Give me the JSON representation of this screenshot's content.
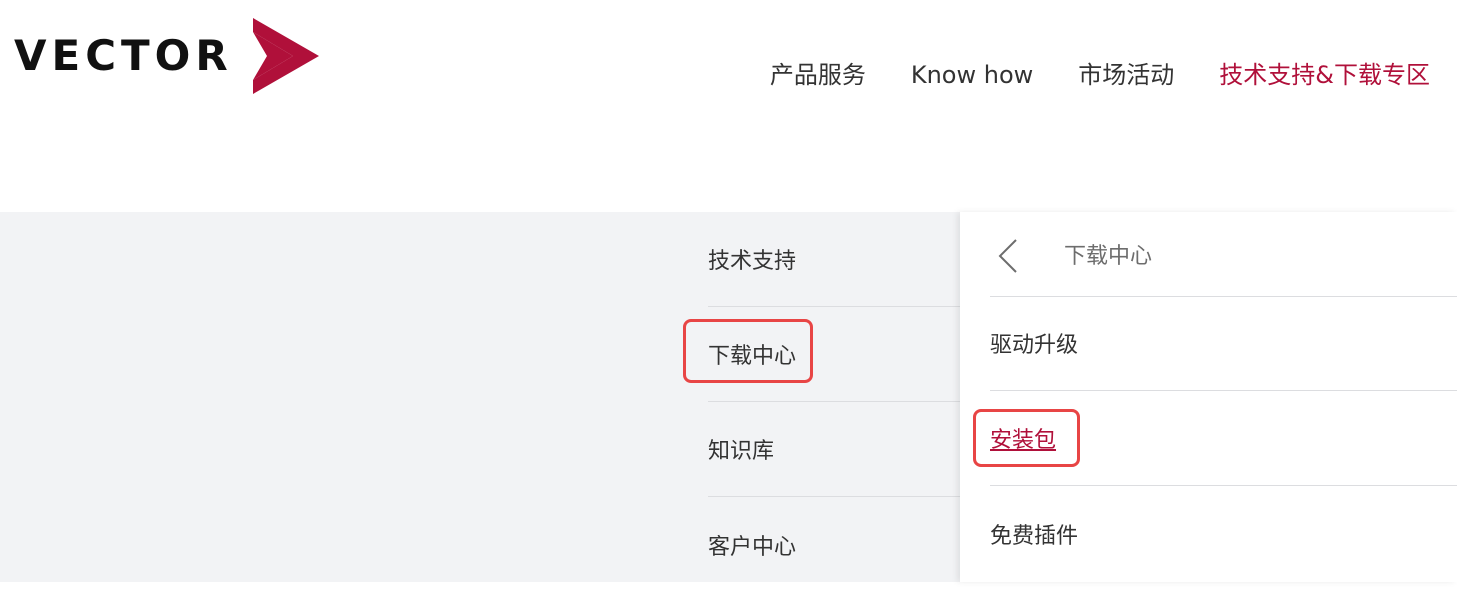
{
  "brand": {
    "logo_text": "VECTOR",
    "logo_icon": "red-chevron-arrow",
    "accent_color": "#b0103a"
  },
  "topnav": {
    "items": [
      {
        "label": "产品服务"
      },
      {
        "label": "Know how"
      },
      {
        "label": "市场活动"
      },
      {
        "label": "技术支持&下载专区",
        "active": true
      }
    ]
  },
  "left_menu": {
    "items": [
      {
        "label": "技术支持"
      },
      {
        "label": "下载中心",
        "highlighted": true
      },
      {
        "label": "知识库"
      },
      {
        "label": "客户中心"
      }
    ]
  },
  "sub_panel": {
    "back_icon": "chevron-left-icon",
    "title": "下载中心",
    "items": [
      {
        "label": "驱动升级"
      },
      {
        "label": "安装包",
        "highlighted": true,
        "link": true
      },
      {
        "label": "免费插件"
      }
    ]
  },
  "highlight_color": "#e84545"
}
